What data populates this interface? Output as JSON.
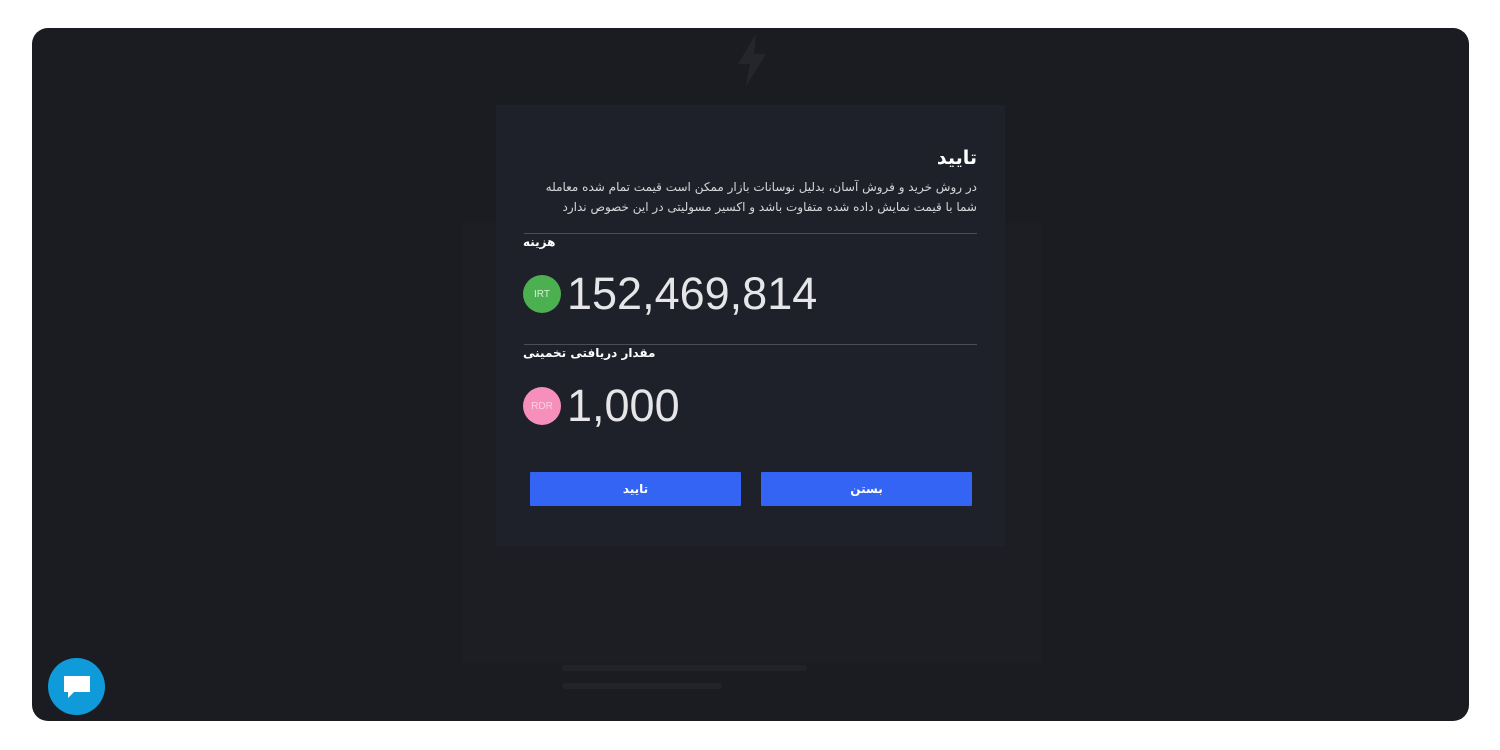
{
  "modal": {
    "title": "تایید",
    "description": "در روش خرید و فروش آسان، بدلیل نوسانات بازار ممکن است قیمت تمام شده معامله شما با قیمت نمایش داده شده متفاوت باشد و اکسیر مسولیتی در این خصوص ندارد",
    "cost": {
      "label": "هزینه",
      "currency": "IRT",
      "currency_color": "#4cb050",
      "amount": "152,469,814"
    },
    "estimated_receive": {
      "label": "مقدار دریافتی تخمینی",
      "currency": "RDR",
      "currency_color": "#f78fbd",
      "amount": "1,000"
    },
    "buttons": {
      "close_label": "بستن",
      "confirm_label": "تایید"
    }
  },
  "colors": {
    "background": "#1b1c21",
    "modal_background": "#1f212a",
    "primary_button": "#3464f4",
    "chat_button": "#0f9ad9"
  },
  "icons": {
    "background_logo": "lightning-icon",
    "chat": "chat-bubble-icon"
  }
}
